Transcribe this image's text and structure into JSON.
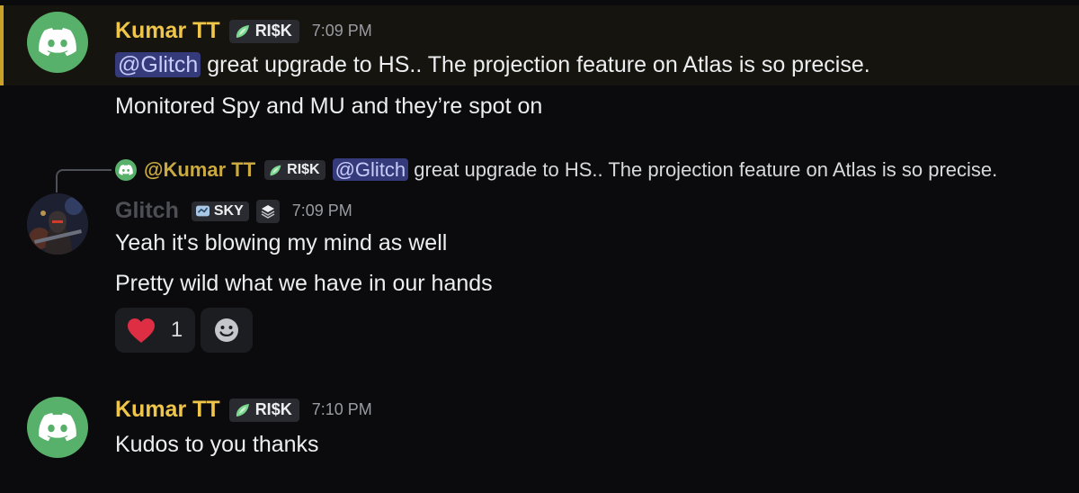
{
  "messages": [
    {
      "author": "Kumar TT",
      "role": "RI$K",
      "time": "7:09 PM",
      "mention": "@Glitch",
      "lines": [
        " great upgrade to HS.. The projection feature on Atlas is so precise.",
        "Monitored Spy and MU and they’re spot on"
      ]
    },
    {
      "reply": {
        "author": "@Kumar TT",
        "role": "RI$K",
        "mention": "@Glitch",
        "text": "great upgrade to HS.. The projection feature on Atlas is so precise."
      },
      "author": "Glitch",
      "role": "SKY",
      "time": "7:09 PM",
      "lines": [
        "Yeah it's blowing my mind as well",
        "Pretty wild what we have in our hands"
      ],
      "reaction": {
        "emoji": "heart",
        "count": "1"
      }
    },
    {
      "author": "Kumar TT",
      "role": "RI$K",
      "time": "7:10 PM",
      "lines": [
        "Kudos to you thanks"
      ]
    }
  ],
  "colors": {
    "background": "#0b0b0d",
    "highlight_bar": "#c9a227",
    "username": "#f0c64a",
    "mention_bg": "#353a7a",
    "avatar_green": "#58b16a"
  },
  "icons": [
    "discord-logo-icon",
    "role-icon",
    "heart-icon",
    "add-reaction-icon"
  ]
}
